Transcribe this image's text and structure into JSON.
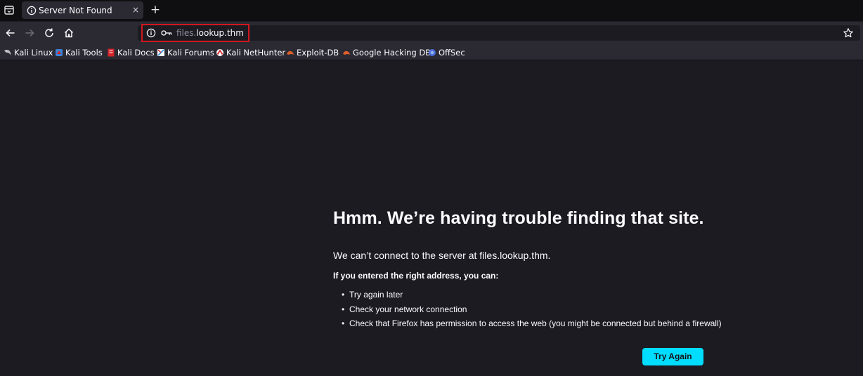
{
  "tab": {
    "title": "Server Not Found",
    "close_glyph": "×",
    "new_tab_glyph": "+"
  },
  "urlbar": {
    "subdomain": "files.",
    "host": "lookup.thm"
  },
  "bookmarks": [
    {
      "label": "Kali Linux",
      "icon": "kali-dragon-icon",
      "color": "#bfbfc7"
    },
    {
      "label": "Kali Tools",
      "icon": "kali-tools-icon",
      "color": "#3b82d6"
    },
    {
      "label": "Kali Docs",
      "icon": "kali-docs-icon",
      "color": "#d4242a"
    },
    {
      "label": "Kali Forums",
      "icon": "kali-forums-icon",
      "color": "#4a9de0"
    },
    {
      "label": "Kali NetHunter",
      "icon": "kali-nethunter-icon",
      "color": "#d4242a"
    },
    {
      "label": "Exploit-DB",
      "icon": "exploit-db-icon",
      "color": "#e0602a"
    },
    {
      "label": "Google Hacking DB",
      "icon": "ghdb-icon",
      "color": "#e0602a"
    },
    {
      "label": "OffSec",
      "icon": "offsec-icon",
      "color": "#4a6fd8"
    }
  ],
  "error": {
    "title": "Hmm. We’re having trouble finding that site.",
    "description": "We can’t connect to the server at files.lookup.thm.",
    "hint": "If you entered the right address, you can:",
    "suggestions": [
      "Try again later",
      "Check your network connection",
      "Check that Firefox has permission to access the web (you might be connected but behind a firewall)"
    ],
    "button_label": "Try Again"
  },
  "colors": {
    "accent": "#00ddff",
    "highlight_box": "#d0181e",
    "background": "#1c1b22",
    "toolbar": "#2b2a33"
  }
}
